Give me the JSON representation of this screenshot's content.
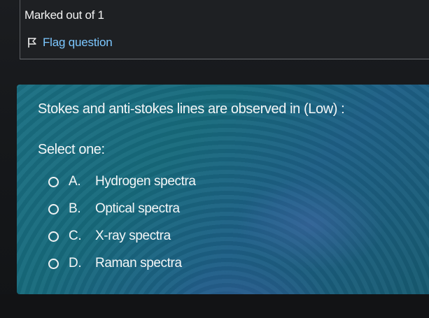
{
  "info": {
    "marks": "Marked out of 1",
    "flag_label": "Flag question",
    "flag_icon": "flag-icon"
  },
  "question": {
    "text": "Stokes and anti-stokes lines are observed in (Low) :",
    "prompt": "Select one:",
    "options": [
      {
        "letter": "A.",
        "text": "Hydrogen spectra"
      },
      {
        "letter": "B.",
        "text": "Optical spectra"
      },
      {
        "letter": "C.",
        "text": "X-ray spectra"
      },
      {
        "letter": "D.",
        "text": "Raman spectra"
      }
    ]
  },
  "colors": {
    "panel_bg": "#1a6f82",
    "link": "#7cc7ff",
    "page_bg": "#16181b"
  }
}
